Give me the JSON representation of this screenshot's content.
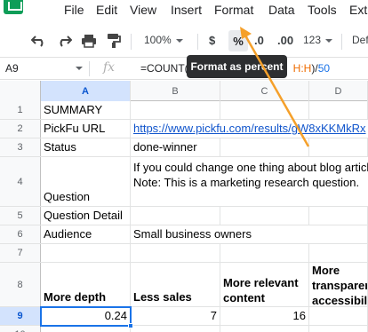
{
  "menu": [
    "File",
    "Edit",
    "View",
    "Insert",
    "Format",
    "Data",
    "Tools",
    "Ext"
  ],
  "toolbar": {
    "zoom": "100%",
    "currency": "$",
    "percent": "%",
    "decrease_decimal": ".0",
    "increase_decimal": ".00",
    "more_formats": "123",
    "font": "Def"
  },
  "tooltip": "Format as percent",
  "formula_bar": {
    "cell_ref": "A9",
    "fx": "fx",
    "formula_start": "=COUNT(",
    "formula_ref": "H:H",
    "formula_mid": ")/",
    "formula_num": "50"
  },
  "columns": [
    "A",
    "B",
    "C",
    "D"
  ],
  "rows": [
    {
      "num": "1",
      "a": "SUMMARY"
    },
    {
      "num": "2",
      "a": "PickFu URL",
      "b": "https://www.pickfu.com/results/gW8xKKMkRx"
    },
    {
      "num": "3",
      "a": "Status",
      "b": "done-winner"
    },
    {
      "num": "4",
      "a": "Question",
      "b_line1": "If you could change one thing about blog articles",
      "b_line2": "",
      "b_line3": "Note: This is a marketing research question."
    },
    {
      "num": "5",
      "a": "Question Detail"
    },
    {
      "num": "6",
      "a": "Audience",
      "b": "Small business owners"
    },
    {
      "num": "7"
    },
    {
      "num": "8",
      "a": "More depth",
      "b": "Less sales",
      "c_line1": "More relevant",
      "c_line2": "content",
      "d_line1": "More",
      "d_line2": "transparency",
      "d_line3": "accessibility"
    },
    {
      "num": "9",
      "a": "0.24",
      "b": "7",
      "c": "16"
    },
    {
      "num": "10"
    }
  ]
}
